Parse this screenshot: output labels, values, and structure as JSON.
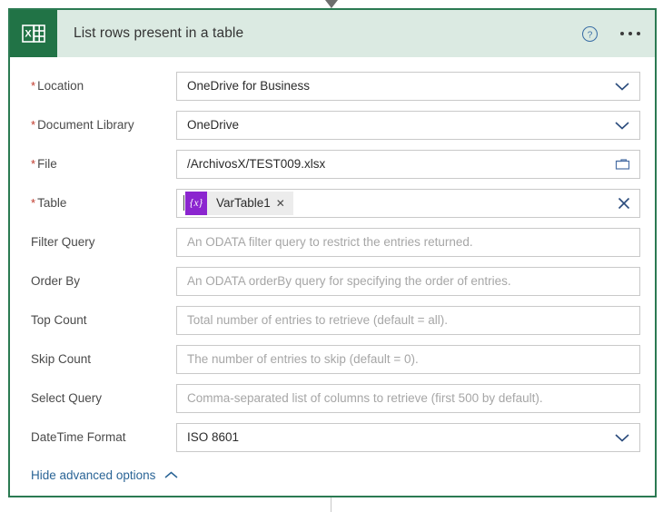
{
  "window": {
    "connector_top_icon": "arrow-down-icon",
    "connector_bottom_icon": "flow-connector-line"
  },
  "header": {
    "app_icon": "excel-icon",
    "title": "List rows present in a table",
    "help_icon": "question-circle-icon",
    "more_icon": "ellipsis-icon",
    "background_color": "#dbeae2",
    "accent_color": "#217346",
    "border_color": "#2b7a52"
  },
  "fields": [
    {
      "label": "Location",
      "required": true,
      "name": "location",
      "type": "dropdown",
      "value": "OneDrive for Business",
      "placeholder": "",
      "trailing_icon": "chevron-down-icon"
    },
    {
      "label": "Document Library",
      "required": true,
      "name": "document-library",
      "type": "dropdown",
      "value": "OneDrive",
      "placeholder": "",
      "trailing_icon": "chevron-down-icon"
    },
    {
      "label": "File",
      "required": true,
      "name": "file",
      "type": "filepicker",
      "value": "/ArchivosX/TEST009.xlsx",
      "placeholder": "",
      "trailing_icon": "folder-icon"
    },
    {
      "label": "Table",
      "required": true,
      "name": "table",
      "type": "token",
      "value": "",
      "placeholder": "",
      "trailing_icon": "clear-x-icon",
      "token": {
        "badge": "{x}",
        "badge_icon": "variable-icon",
        "text": "VarTable1",
        "remove_icon": "token-remove-icon",
        "badge_color": "#8b25cf",
        "chip_color": "#ececec"
      }
    },
    {
      "label": "Filter Query",
      "required": false,
      "name": "filter-query",
      "type": "text",
      "value": "",
      "placeholder": "An ODATA filter query to restrict the entries returned.",
      "trailing_icon": ""
    },
    {
      "label": "Order By",
      "required": false,
      "name": "order-by",
      "type": "text",
      "value": "",
      "placeholder": "An ODATA orderBy query for specifying the order of entries.",
      "trailing_icon": ""
    },
    {
      "label": "Top Count",
      "required": false,
      "name": "top-count",
      "type": "text",
      "value": "",
      "placeholder": "Total number of entries to retrieve (default = all).",
      "trailing_icon": ""
    },
    {
      "label": "Skip Count",
      "required": false,
      "name": "skip-count",
      "type": "text",
      "value": "",
      "placeholder": "The number of entries to skip (default = 0).",
      "trailing_icon": ""
    },
    {
      "label": "Select Query",
      "required": false,
      "name": "select-query",
      "type": "text",
      "value": "",
      "placeholder": "Comma-separated list of columns to retrieve (first 500 by default).",
      "trailing_icon": ""
    },
    {
      "label": "DateTime Format",
      "required": false,
      "name": "datetime-format",
      "type": "dropdown",
      "value": "ISO 8601",
      "placeholder": "",
      "trailing_icon": "chevron-down-icon"
    }
  ],
  "footer": {
    "advanced_options_label": "Hide advanced options",
    "advanced_options_icon": "chevron-up-icon",
    "link_color": "#2a6496"
  }
}
